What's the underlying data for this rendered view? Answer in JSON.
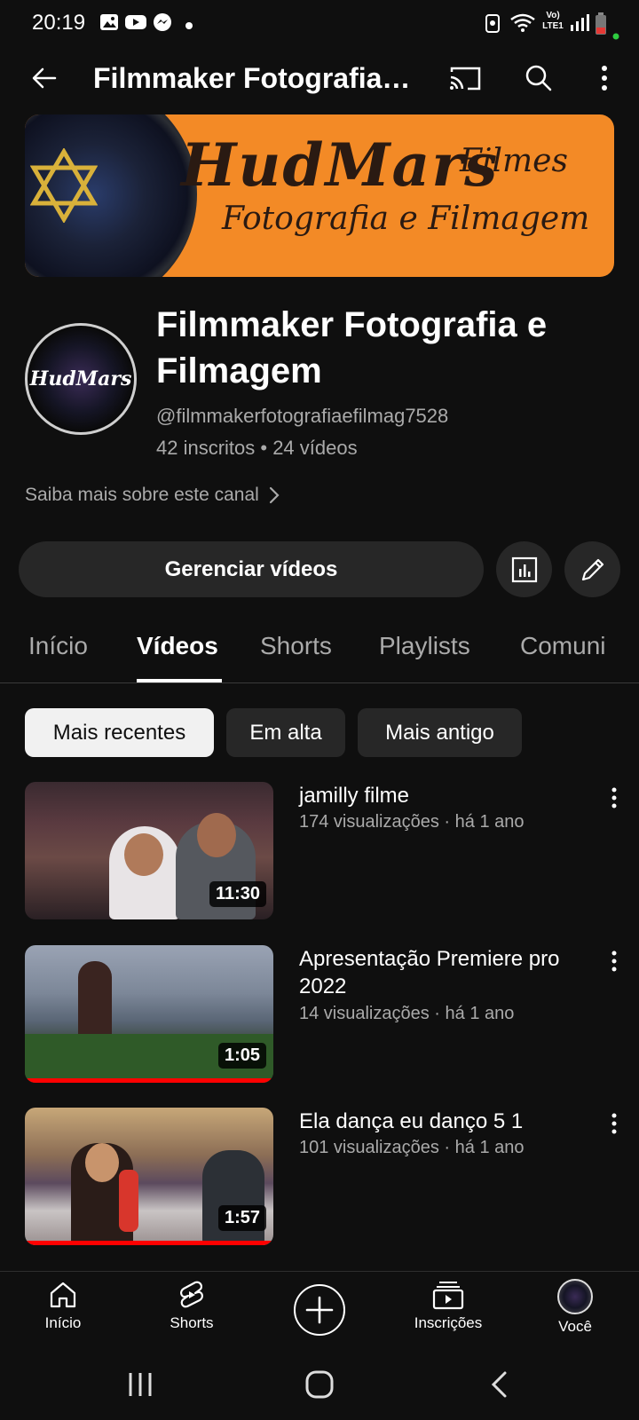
{
  "status_bar": {
    "time": "20:19",
    "icons_left": [
      "gallery-icon",
      "youtube-icon",
      "messenger-icon",
      "dot-icon"
    ],
    "icons_right": [
      "battery-saver-icon",
      "wifi-icon",
      "volte-icon",
      "signal-icon",
      "battery-icon"
    ],
    "volte_label": "Vo) LTE1"
  },
  "app_bar": {
    "title": "Filmmaker Fotografia…",
    "icons": [
      "back-arrow-icon",
      "cast-icon",
      "search-icon",
      "more-vert-icon"
    ]
  },
  "banner": {
    "brand": "HudMars",
    "script": "Filmes",
    "subtitle": "Fotografia e Filmagem"
  },
  "channel": {
    "avatar_text": "HudMars",
    "name": "Filmmaker Fotografia e Filmagem",
    "handle": "@filmmakerfotografiaefilmag7528",
    "stats": "42 inscritos • 24 vídeos",
    "learn_more": "Saiba mais sobre este canal"
  },
  "actions": {
    "manage_label": "Gerenciar vídeos",
    "analytics_icon": "analytics-icon",
    "edit_icon": "pencil-icon"
  },
  "tabs": [
    {
      "label": "Início",
      "active": false
    },
    {
      "label": "Vídeos",
      "active": true
    },
    {
      "label": "Shorts",
      "active": false
    },
    {
      "label": "Playlists",
      "active": false
    },
    {
      "label": "Comuni",
      "active": false
    }
  ],
  "chips": [
    {
      "label": "Mais recentes",
      "selected": true
    },
    {
      "label": "Em alta",
      "selected": false
    },
    {
      "label": "Mais antigo",
      "selected": false
    }
  ],
  "videos": [
    {
      "title": "jamilly filme",
      "meta": "174 visualizações · há 1 ano",
      "duration": "11:30",
      "watched_progress": 0
    },
    {
      "title": "Apresentação Premiere pro 2022",
      "meta": "14 visualizações · há 1 ano",
      "duration": "1:05",
      "watched_progress": 1.0
    },
    {
      "title": "Ela dança eu danço 5 1",
      "meta": "101 visualizações · há 1 ano",
      "duration": "1:57",
      "watched_progress": 1.0
    }
  ],
  "bottom_nav": [
    {
      "label": "Início",
      "icon": "home-icon"
    },
    {
      "label": "Shorts",
      "icon": "shorts-icon"
    },
    {
      "label": "",
      "icon": "create-plus-icon"
    },
    {
      "label": "Inscrições",
      "icon": "subscriptions-icon"
    },
    {
      "label": "Você",
      "icon": "profile-avatar-icon"
    }
  ],
  "system_nav": [
    "recents-icon",
    "home-circle-icon",
    "back-chevron-icon"
  ],
  "colors": {
    "background": "#0f0f0f",
    "surface": "#272727",
    "text_secondary": "#aaaaaa",
    "banner_orange": "#f38a26",
    "progress_red": "#ff0000"
  }
}
